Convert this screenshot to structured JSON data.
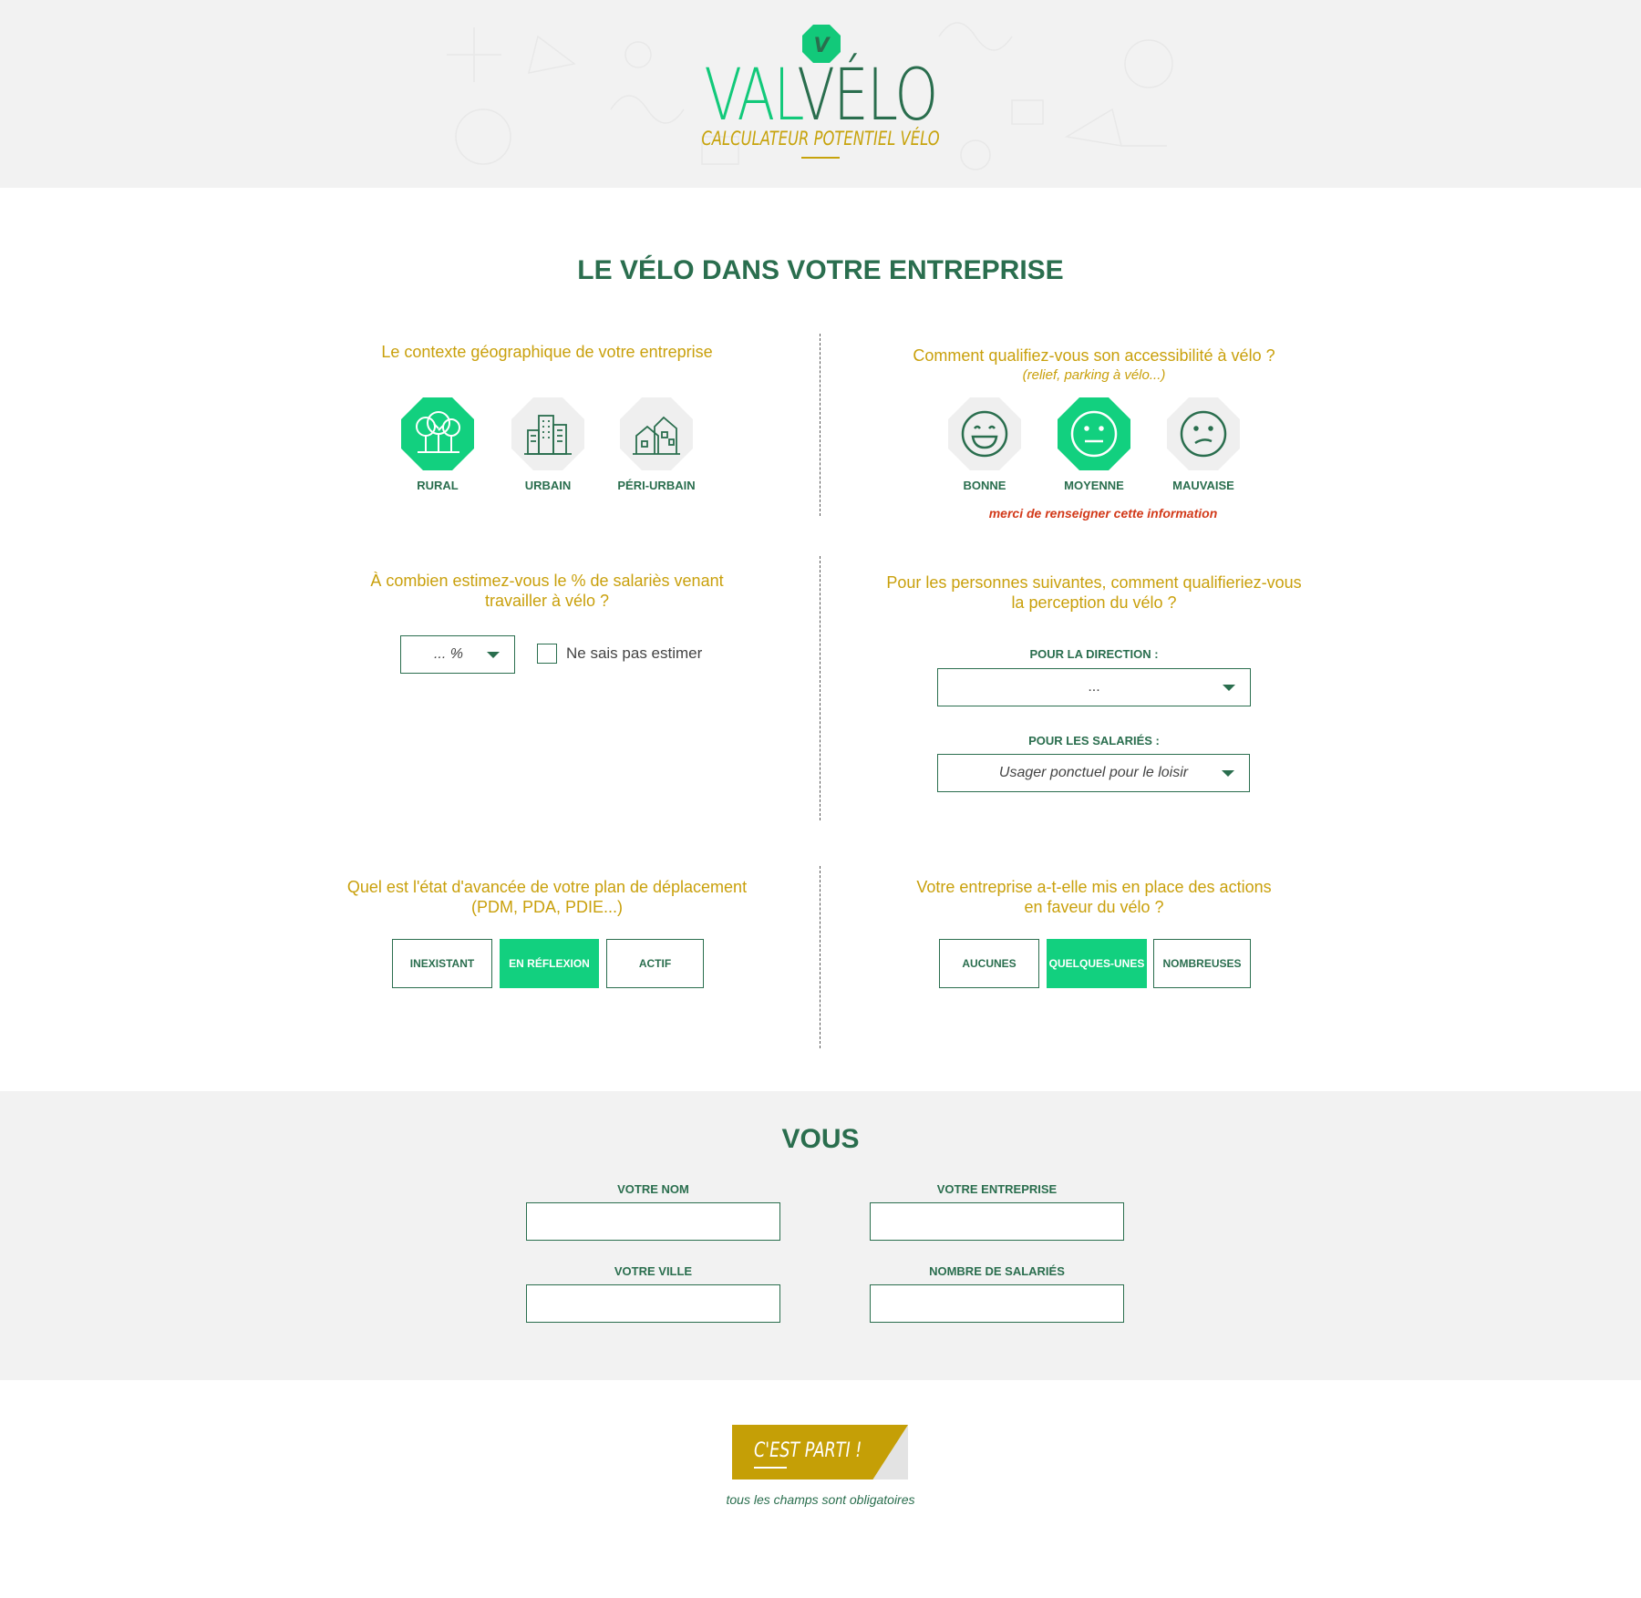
{
  "header": {
    "logo_letter": "V",
    "logo_val": "VAL",
    "logo_velo": "VÉLO",
    "subtitle": "CALCULATEUR POTENTIEL VÉLO"
  },
  "entreprise": {
    "title": "LE VÉLO DANS VOTRE ENTREPRISE",
    "geo": {
      "question": "Le contexte géographique de votre  entreprise",
      "options": [
        {
          "label": "RURAL",
          "icon": "trees-icon",
          "selected": true
        },
        {
          "label": "URBAIN",
          "icon": "city-buildings-icon",
          "selected": false
        },
        {
          "label": "PÉRI-URBAIN",
          "icon": "suburban-houses-icon",
          "selected": false
        }
      ]
    },
    "accessibility": {
      "question": "Comment qualifiez-vous son accessibilité à vélo ?",
      "hint": "(relief, parking à vélo...)",
      "options": [
        {
          "label": "BONNE",
          "icon": "happy-face-icon",
          "selected": false
        },
        {
          "label": "MOYENNE",
          "icon": "neutral-face-icon",
          "selected": true
        },
        {
          "label": "MAUVAISE",
          "icon": "sad-face-icon",
          "selected": false
        }
      ],
      "warning": "merci de renseigner cette information"
    },
    "percent": {
      "question_line1": "À combien estimez-vous le % de salariès venant",
      "question_line2": "travailler à vélo ?",
      "select_value": "... %",
      "checkbox_label": "Ne sais pas estimer",
      "checkbox_checked": false
    },
    "perception": {
      "question_line1": "Pour les personnes suivantes, comment qualifieriez-vous",
      "question_line2": "la perception du vélo ?",
      "direction_label": "POUR LA DIRECTION :",
      "direction_value": "...",
      "salaries_label": "POUR LES SALARIÉS :",
      "salaries_value": "Usager ponctuel pour le loisir"
    },
    "plan": {
      "question_line1": "Quel est l'état d'avancée de votre plan de déplacement",
      "question_line2": "(PDM, PDA, PDIE...)",
      "options": [
        {
          "label": "INEXISTANT",
          "selected": false
        },
        {
          "label": "EN RÉFLEXION",
          "selected": true
        },
        {
          "label": "ACTIF",
          "selected": false
        }
      ]
    },
    "actions": {
      "question_line1": "Votre entreprise a-t-elle mis en place des actions",
      "question_line2": "en faveur du vélo ?",
      "options": [
        {
          "label": "AUCUNES",
          "selected": false
        },
        {
          "label": "QUELQUES-UNES",
          "selected": true
        },
        {
          "label": "NOMBREUSES",
          "selected": false
        }
      ]
    }
  },
  "vous": {
    "title": "VOUS",
    "fields": {
      "nom": {
        "label": "VOTRE NOM",
        "value": ""
      },
      "entreprise": {
        "label": "VOTRE ENTREPRISE",
        "value": ""
      },
      "ville": {
        "label": "VOTRE VILLE",
        "value": ""
      },
      "salaries": {
        "label": "NOMBRE DE SALARIÉS",
        "value": ""
      }
    }
  },
  "cta": {
    "label": "C'EST PARTI !",
    "note": "tous les champs sont obligatoires"
  },
  "colors": {
    "green_dark": "#2a6e4e",
    "green_bright": "#12d07f",
    "gold": "#c59f06",
    "warning": "#d23a1a"
  }
}
